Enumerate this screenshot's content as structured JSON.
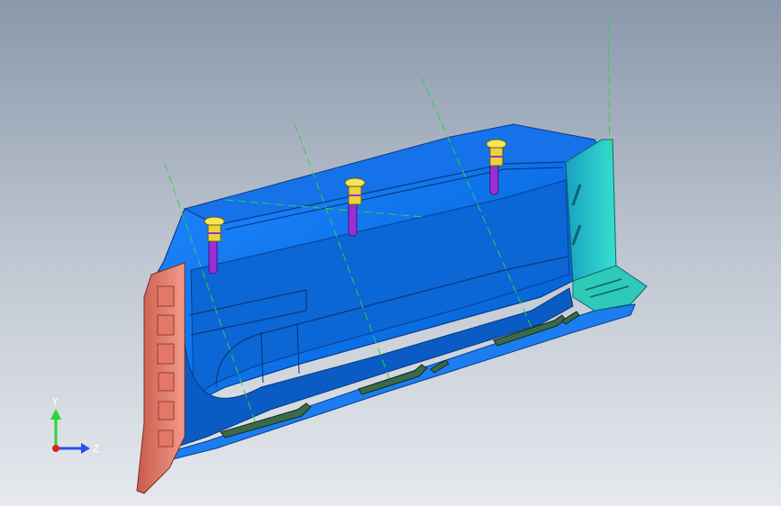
{
  "viewport": {
    "background_top": "#8a98ab",
    "background_bottom": "#e6e9ee",
    "model_color": "#0a6fe6",
    "flange_color": "#f08a7a",
    "end_cap_color": "#2fd3c8",
    "fastener_cap_color": "#f3e65a",
    "fastener_pin_color": "#9b2fd6",
    "centerline_color": "#2fd04a"
  },
  "triad": {
    "y_label": "Y",
    "z_label": "Z",
    "y_color": "#27d43a",
    "z_color": "#2a4df0",
    "x_color": "#e02020"
  }
}
